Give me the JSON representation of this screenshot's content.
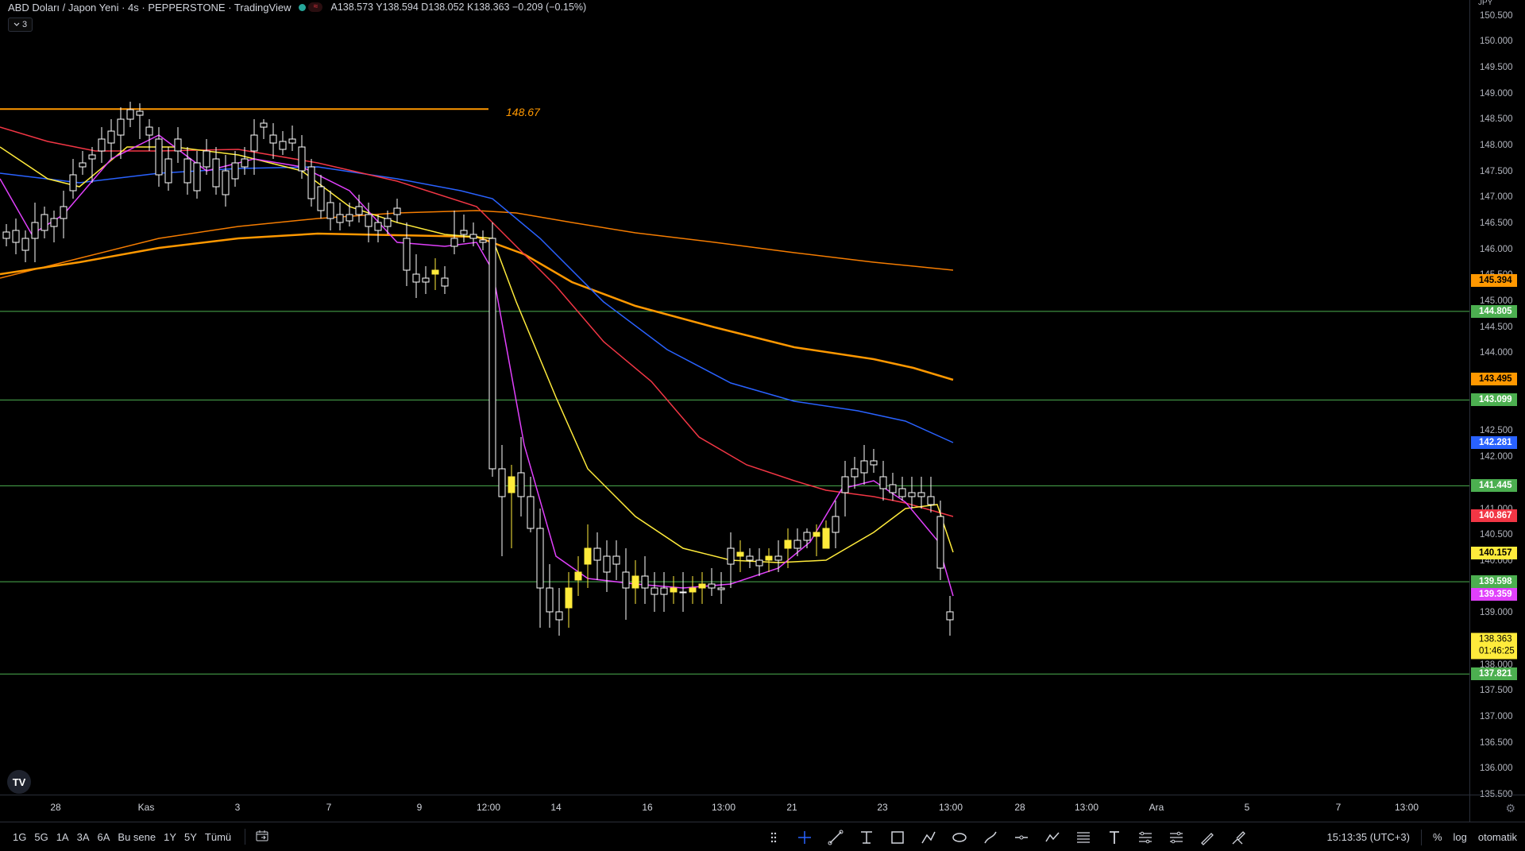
{
  "header": {
    "title": "ABD Doları / Japon Yeni · 4s · PEPPERSTONE · TradingView",
    "status_icon_green": "market-open-dot",
    "status_icon_red": "≈",
    "ohlc": {
      "open_label": "A",
      "open": "138.573",
      "high_label": "Y",
      "high": "138.594",
      "low_label": "D",
      "low": "138.052",
      "close_label": "K",
      "close": "138.363",
      "change": "−0.209 (−0.15%)"
    }
  },
  "indicator_toggle": {
    "icon": "chevron-down-icon",
    "count": "3"
  },
  "chart": {
    "resistance_line_label": "148.67",
    "resistance_line_value": 148.67,
    "horizontal_levels": [
      144.805,
      143.099,
      141.445,
      139.598,
      137.821
    ],
    "colors": {
      "candle_up": "#ffeb3b",
      "candle_down": "#ffffff",
      "ma_magenta": "#e040fb",
      "ma_yellow": "#ffeb3b",
      "ma_red": "#f23645",
      "ma_blue": "#2962ff",
      "ma_orange": "#ff9800",
      "ma_orange_light": "#f57c00",
      "level_line": "#4caf50",
      "resistance": "#ff9800"
    }
  },
  "price_axis": {
    "unit": "JPY",
    "ticks": [
      "150.500",
      "150.000",
      "149.500",
      "149.000",
      "148.500",
      "148.000",
      "147.500",
      "147.000",
      "146.500",
      "146.000",
      "145.500",
      "145.000",
      "144.500",
      "144.000",
      "143.500",
      "142.500",
      "142.000",
      "141.000",
      "140.500",
      "140.000",
      "139.000",
      "138.500",
      "138.000",
      "137.500",
      "137.000",
      "136.500",
      "136.000",
      "135.500"
    ],
    "badges": [
      {
        "value": "145.394",
        "bg": "#ff9800",
        "fg": "#000000"
      },
      {
        "value": "144.805",
        "bg": "#4caf50",
        "fg": "#ffffff"
      },
      {
        "value": "143.495",
        "bg": "#ff9800",
        "fg": "#000000"
      },
      {
        "value": "143.099",
        "bg": "#4caf50",
        "fg": "#ffffff"
      },
      {
        "value": "142.281",
        "bg": "#2962ff",
        "fg": "#ffffff"
      },
      {
        "value": "141.445",
        "bg": "#4caf50",
        "fg": "#ffffff"
      },
      {
        "value": "140.867",
        "bg": "#f23645",
        "fg": "#ffffff"
      },
      {
        "value": "140.157",
        "bg": "#ffeb3b",
        "fg": "#000000"
      },
      {
        "value": "139.598",
        "bg": "#4caf50",
        "fg": "#ffffff"
      },
      {
        "value": "139.359",
        "bg": "#e040fb",
        "fg": "#ffffff"
      },
      {
        "value": "137.821",
        "bg": "#4caf50",
        "fg": "#ffffff"
      }
    ],
    "current_price": "138.363",
    "countdown": "01:46:25"
  },
  "time_axis": {
    "ticks": [
      "28",
      "Kas",
      "3",
      "7",
      "9",
      "12:00",
      "14",
      "16",
      "13:00",
      "21",
      "23",
      "13:00",
      "28",
      "13:00",
      "Ara",
      "5",
      "7",
      "13:00"
    ]
  },
  "bottom_bar": {
    "ranges": [
      "1G",
      "5G",
      "1A",
      "3A",
      "6A",
      "Bu sene",
      "1Y",
      "5Y",
      "Tümü"
    ],
    "compare_icon": "calendar-range-icon",
    "drawing_tools": [
      "drag-handle-icon",
      "crosshair-icon",
      "trend-line-icon",
      "horizontal-ray-icon",
      "rectangle-icon",
      "path-icon",
      "ellipse-icon",
      "brush-icon",
      "horizontal-line-icon",
      "polyline-icon",
      "fib-retracement-icon",
      "text-icon",
      "pitchfork-icon",
      "gann-icon",
      "pencil-icon",
      "highlighter-icon"
    ],
    "time": "15:13:35 (UTC+3)",
    "percent_label": "%",
    "log_label": "log",
    "auto_label": "otomatik"
  }
}
